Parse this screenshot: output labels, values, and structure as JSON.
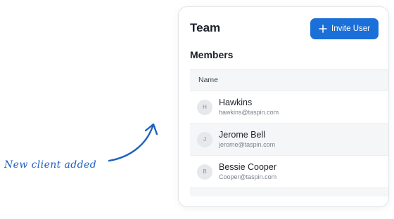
{
  "annotation": {
    "text": "New client added"
  },
  "header": {
    "title": "Team",
    "invite_label": "Invite User"
  },
  "members": {
    "title": "Members",
    "column_name": "Name",
    "rows": [
      {
        "initial": "H",
        "name": "Hawkins",
        "email": "hawkins@taspin.com"
      },
      {
        "initial": "J",
        "name": "Jerome Bell",
        "email": "jerome@taspin.com"
      },
      {
        "initial": "B",
        "name": "Bessie Cooper",
        "email": "Cooper@taspin.com"
      }
    ]
  },
  "colors": {
    "accent": "#1b6fd8",
    "annotation": "#1f5fc2"
  },
  "icons": {
    "invite": "plus-icon"
  }
}
